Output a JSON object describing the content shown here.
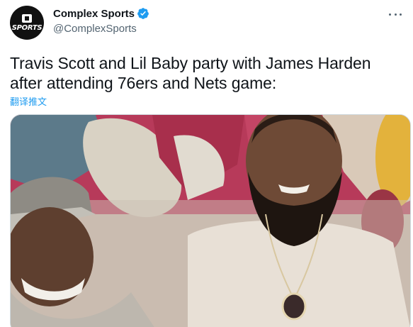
{
  "account": {
    "display_name": "Complex Sports",
    "handle": "@ComplexSports",
    "avatar_text": "SPORTS",
    "verified": true
  },
  "tweet": {
    "text": "Travis Scott and Lil Baby party with James Harden after attending 76ers and Nets game:",
    "translate_label": "翻译推文"
  },
  "icons": {
    "more": "more-horizontal-icon",
    "verified": "verified-badge-icon"
  },
  "colors": {
    "link": "#1d9bf0",
    "secondary_text": "#536471",
    "verified": "#1d9bf0"
  }
}
